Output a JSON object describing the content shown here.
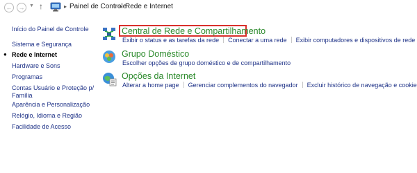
{
  "address_bar": {
    "back_icon": "back-arrow-icon",
    "forward_icon": "forward-arrow-icon",
    "recent_icon": "chevron-down-icon",
    "up_icon": "up-arrow-icon",
    "crumbs": [
      "Painel de Controle",
      "Rede e Internet"
    ]
  },
  "sidebar": {
    "home": "Início do Painel de Controle",
    "items": [
      {
        "label": "Sistema e Segurança",
        "current": false
      },
      {
        "label": "Rede e Internet",
        "current": true
      },
      {
        "label": "Hardware e Sons",
        "current": false
      },
      {
        "label": "Programas",
        "current": false
      },
      {
        "label": "Contas Usuário e Proteção p/",
        "label_line2": "Família",
        "current": false
      },
      {
        "label": "Aparência e Personalização",
        "current": false
      },
      {
        "label": "Relógio, Idioma e Região",
        "current": false
      },
      {
        "label": "Facilidade de Acesso",
        "current": false
      }
    ]
  },
  "categories": [
    {
      "title": "Central de Rede e Compartilhamento",
      "icon": "network-sharing-center-icon",
      "highlighted": true,
      "tasks": [
        "Exibir o status e as tarefas da rede",
        "Conectar a uma rede",
        "Exibir computadores e dispositivos de rede"
      ]
    },
    {
      "title": "Grupo Doméstico",
      "icon": "homegroup-icon",
      "highlighted": false,
      "tasks": [
        "Escolher opções de grupo doméstico e de compartilhamento"
      ]
    },
    {
      "title": "Opções da Internet",
      "icon": "internet-options-icon",
      "highlighted": false,
      "tasks": [
        "Alterar a home page",
        "Gerenciar complementos do navegador",
        "Excluir histórico de navegação e cookies"
      ]
    }
  ],
  "colors": {
    "link": "#1e3287",
    "category_title": "#2c8a2c",
    "highlight": "#d9302c"
  }
}
